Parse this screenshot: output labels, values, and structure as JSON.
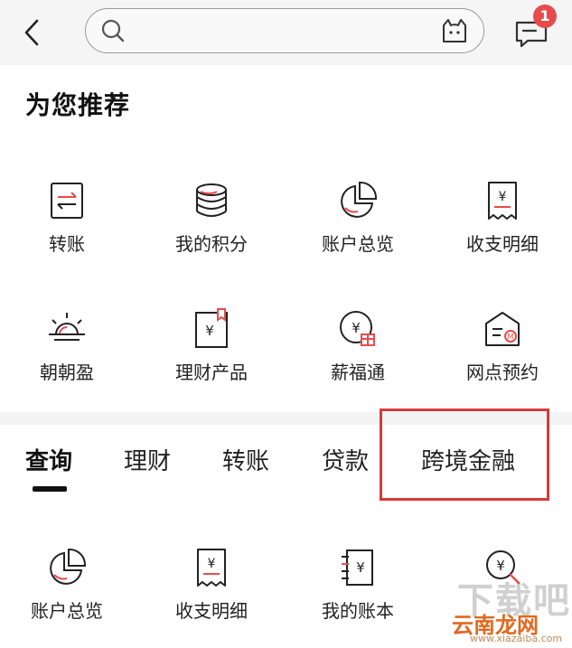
{
  "header": {
    "search_placeholder": "",
    "badge_count": "1"
  },
  "recommended": {
    "title": "为您推荐",
    "items": [
      {
        "label": "转账",
        "icon": "transfer-icon"
      },
      {
        "label": "我的积分",
        "icon": "points-icon"
      },
      {
        "label": "账户总览",
        "icon": "pie-chart-icon"
      },
      {
        "label": "收支明细",
        "icon": "receipt-icon"
      },
      {
        "label": "朝朝盈",
        "icon": "sunrise-icon"
      },
      {
        "label": "理财产品",
        "icon": "wealth-product-icon"
      },
      {
        "label": "薪福通",
        "icon": "salary-gift-icon"
      },
      {
        "label": "网点预约",
        "icon": "branch-appointment-icon"
      }
    ]
  },
  "tabs": [
    {
      "label": "查询",
      "active": true
    },
    {
      "label": "理财",
      "active": false
    },
    {
      "label": "转账",
      "active": false
    },
    {
      "label": "贷款",
      "active": false
    },
    {
      "label": "跨境金融",
      "active": false
    }
  ],
  "query_items": [
    {
      "label": "账户总览",
      "icon": "pie-chart-icon"
    },
    {
      "label": "收支明细",
      "icon": "receipt-icon"
    },
    {
      "label": "我的账本",
      "icon": "ledger-icon"
    },
    {
      "label": "",
      "icon": "search-yuan-icon"
    }
  ],
  "watermark": {
    "line1": "下载吧",
    "line2": "云南龙网",
    "line3": "www.xiazaiba.com"
  },
  "colors": {
    "accent": "#e84b4b",
    "highlight_border": "#d73a3a",
    "top_bar_bg": "#f5f5f5",
    "tab_underline": "#111111"
  }
}
